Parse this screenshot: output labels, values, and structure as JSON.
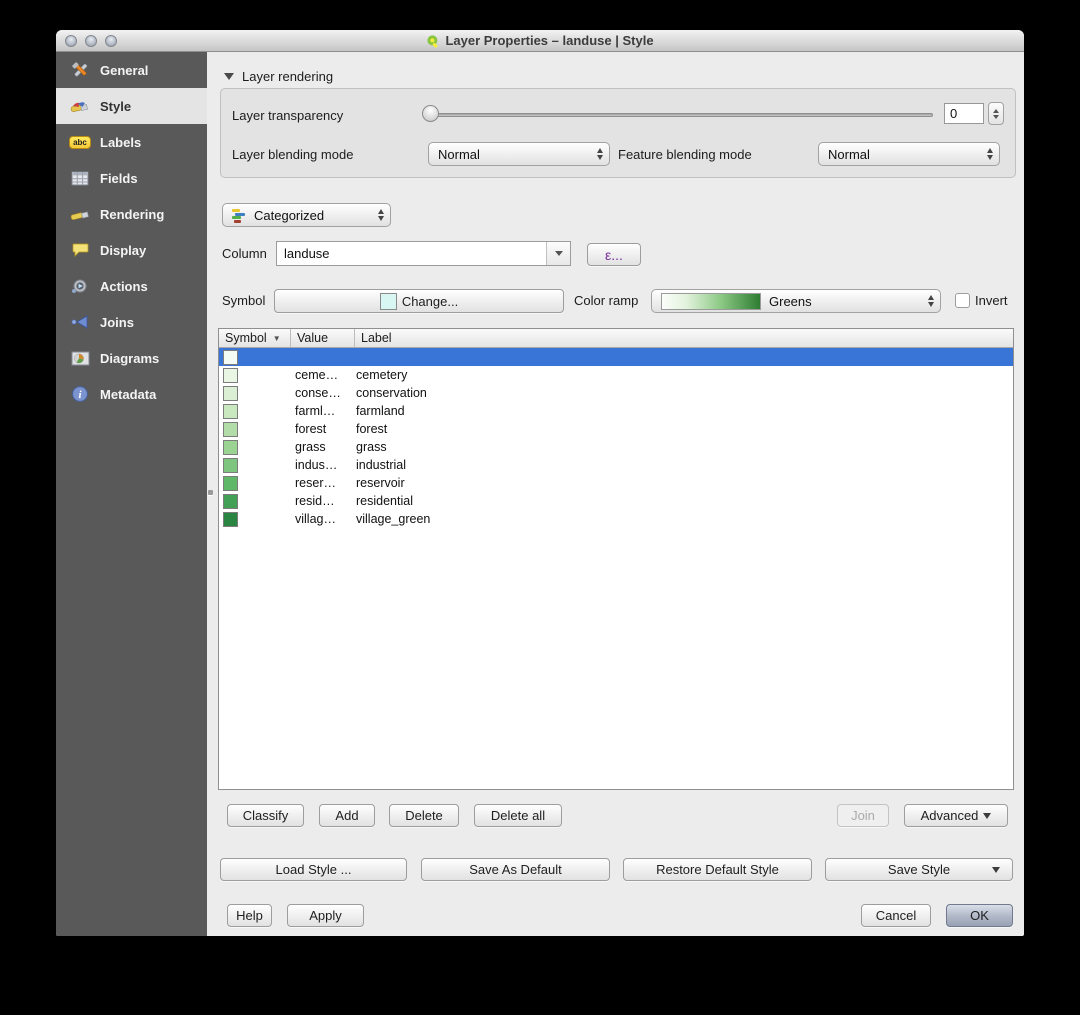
{
  "window": {
    "title": "Layer Properties – landuse | Style"
  },
  "sidebar": {
    "items": [
      {
        "label": "General",
        "icon": "tools-icon"
      },
      {
        "label": "Style",
        "icon": "paintbrush-icon"
      },
      {
        "label": "Labels",
        "icon": "abc-tag-icon",
        "badge": "abc"
      },
      {
        "label": "Fields",
        "icon": "table-icon"
      },
      {
        "label": "Rendering",
        "icon": "brush-icon"
      },
      {
        "label": "Display",
        "icon": "speech-bubble-icon"
      },
      {
        "label": "Actions",
        "icon": "gear-play-icon"
      },
      {
        "label": "Joins",
        "icon": "join-arrow-icon"
      },
      {
        "label": "Diagrams",
        "icon": "pie-chart-icon"
      },
      {
        "label": "Metadata",
        "icon": "info-icon"
      }
    ]
  },
  "rendering": {
    "section_label": "Layer rendering",
    "transparency_label": "Layer transparency",
    "transparency_value": "0",
    "layer_blend_label": "Layer blending mode",
    "layer_blend_value": "Normal",
    "feature_blend_label": "Feature blending mode",
    "feature_blend_value": "Normal"
  },
  "symbology": {
    "renderer_value": "Categorized",
    "column_label": "Column",
    "column_value": "landuse",
    "expression_button": "ε...",
    "symbol_label": "Symbol",
    "symbol_color": "#d8f6f2",
    "change_button": "Change...",
    "color_ramp_label": "Color ramp",
    "color_ramp_value": "Greens",
    "ramp_gradient": "linear-gradient(90deg,#fbfefa,#e2f2dc 25%,#8cc985 60%,#2e7d32)",
    "invert_label": "Invert"
  },
  "table": {
    "columns": [
      "Symbol",
      "Value",
      "Label"
    ],
    "rows": [
      {
        "color": "#f4faf4",
        "value": "",
        "label": "",
        "selected": true
      },
      {
        "color": "#e8f6e3",
        "value": "ceme…",
        "label": "cemetery"
      },
      {
        "color": "#daefd3",
        "value": "conse…",
        "label": "conservation"
      },
      {
        "color": "#c9e8bf",
        "value": "farml…",
        "label": "farmland"
      },
      {
        "color": "#b3dda8",
        "value": "forest",
        "label": "forest"
      },
      {
        "color": "#9ad392",
        "value": "grass",
        "label": "grass"
      },
      {
        "color": "#7ec67f",
        "value": "indus…",
        "label": "industrial"
      },
      {
        "color": "#5fb868",
        "value": "reser…",
        "label": "reservoir"
      },
      {
        "color": "#41a055",
        "value": "resid…",
        "label": "residential"
      },
      {
        "color": "#2a8442",
        "value": "villag…",
        "label": "village_green"
      }
    ]
  },
  "actions": {
    "classify": "Classify",
    "add": "Add",
    "delete": "Delete",
    "delete_all": "Delete all",
    "join": "Join",
    "advanced": "Advanced"
  },
  "style_buttons": {
    "load": "Load Style ...",
    "save_default": "Save As Default",
    "restore": "Restore Default Style",
    "save_style": "Save Style"
  },
  "dialog_buttons": {
    "help": "Help",
    "apply": "Apply",
    "cancel": "Cancel",
    "ok": "OK"
  },
  "colors": {
    "selection_blue": "#3875d7",
    "sidebar_gray": "#595959"
  }
}
